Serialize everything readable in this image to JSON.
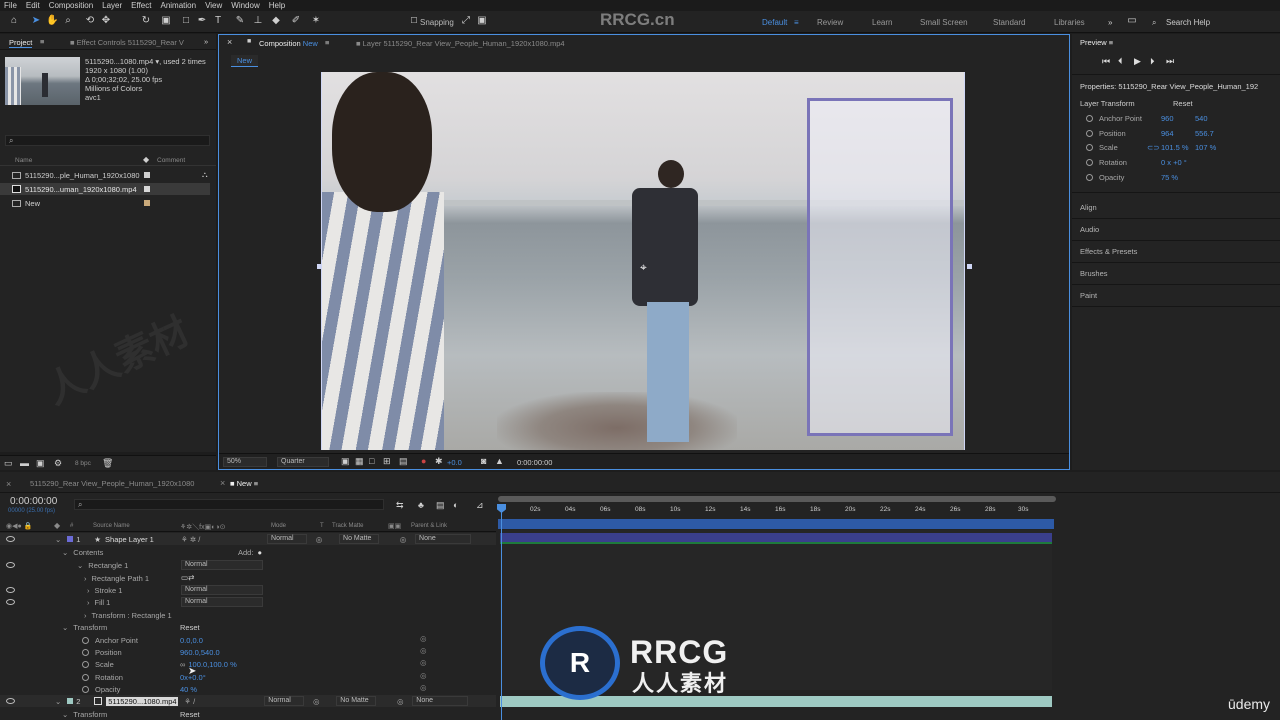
{
  "menu": [
    "File",
    "Edit",
    "Composition",
    "Layer",
    "Effect",
    "Animation",
    "View",
    "Window",
    "Help"
  ],
  "toolbar": {
    "snapping": "Snapping",
    "workspaces": [
      "Default",
      "Review",
      "Learn",
      "Small Screen",
      "Standard",
      "Libraries"
    ],
    "search": "Search Help"
  },
  "watermark": {
    "top": "RRCG.cn",
    "logo_main": "RRCG",
    "logo_sub": "人人素材",
    "side": "人人素材",
    "udemy": "ūdemy"
  },
  "project": {
    "tab": "Project",
    "effect_tab": "Effect Controls 5115290_Rear V",
    "info": [
      "5115290...1080.mp4 ▾, used 2 times",
      "1920 x 1080 (1.00)",
      "Δ 0;00;32;02, 25.00 fps",
      "Millions of Colors",
      "avc1"
    ],
    "cols": {
      "name": "Name",
      "comment": "Comment"
    },
    "items": [
      "5115290...ple_Human_1920x1080",
      "5115290...uman_1920x1080.mp4",
      "New"
    ],
    "bpc": "8 bpc"
  },
  "viewer": {
    "comp_tab": "Composition",
    "comp_name": "New",
    "layer_tab": "Layer 5115290_Rear View_People_Human_1920x1080.mp4",
    "sub_tab": "New",
    "zoom": "50%",
    "quality": "Quarter",
    "exposure": "+0.0",
    "timecode": "0:00:00:00"
  },
  "right": {
    "preview": "Preview",
    "properties": "Properties: 5115290_Rear View_People_Human_192",
    "layer_transform": "Layer Transform",
    "reset": "Reset",
    "props": [
      {
        "name": "Anchor Point",
        "v1": "960",
        "v2": "540"
      },
      {
        "name": "Position",
        "v1": "964",
        "v2": "556.7"
      },
      {
        "name": "Scale",
        "v1": "101.5 %",
        "v2": "107 %"
      },
      {
        "name": "Rotation",
        "v1": "0 x +0 °",
        "v2": ""
      },
      {
        "name": "Opacity",
        "v1": "75 %",
        "v2": ""
      }
    ],
    "panels": [
      "Align",
      "Audio",
      "Effects & Presets",
      "Brushes",
      "Paint"
    ]
  },
  "timeline": {
    "tab1": "5115290_Rear View_People_Human_1920x1080",
    "tab2": "New",
    "time": "0:00:00:00",
    "time_sub": "00000 (25.00 fps)",
    "cols": {
      "source": "Source Name",
      "mode": "Mode",
      "t": "T",
      "trackmatte": "Track Matte",
      "parent": "Parent & Link"
    },
    "layer1": {
      "num": "1",
      "name": "Shape Layer 1",
      "mode": "Normal",
      "matte": "No Matte",
      "parent": "None"
    },
    "contents": "Contents",
    "add": "Add:",
    "rect": "Rectangle 1",
    "rect_mode": "Normal",
    "rect_children": [
      {
        "name": "Rectangle Path 1",
        "mode": ""
      },
      {
        "name": "Stroke 1",
        "mode": "Normal"
      },
      {
        "name": "Fill 1",
        "mode": "Normal"
      },
      {
        "name": "Transform : Rectangle 1",
        "mode": ""
      }
    ],
    "transform": "Transform",
    "reset": "Reset",
    "tprops": [
      {
        "name": "Anchor Point",
        "value": "0.0,0.0"
      },
      {
        "name": "Position",
        "value": "960.0,540.0"
      },
      {
        "name": "Scale",
        "value": "100.0,100.0 %"
      },
      {
        "name": "Rotation",
        "value": "0x+0.0°"
      },
      {
        "name": "Opacity",
        "value": "40 %"
      }
    ],
    "layer2": {
      "num": "2",
      "name": "5115290...1080.mp4",
      "mode": "Normal",
      "matte": "No Matte",
      "parent": "None"
    },
    "transform2": "Transform",
    "reset2": "Reset",
    "ruler": [
      "0s",
      "02s",
      "04s",
      "06s",
      "08s",
      "10s",
      "12s",
      "14s",
      "16s",
      "18s",
      "20s",
      "22s",
      "24s",
      "26s",
      "28s",
      "30s"
    ]
  },
  "colors": {
    "accent": "#4a8fe0",
    "bar1": "#3a3f8c",
    "bar2": "#1e7a3c",
    "bar3": "#9ec9c2",
    "label_purple": "#6b6bd6"
  }
}
